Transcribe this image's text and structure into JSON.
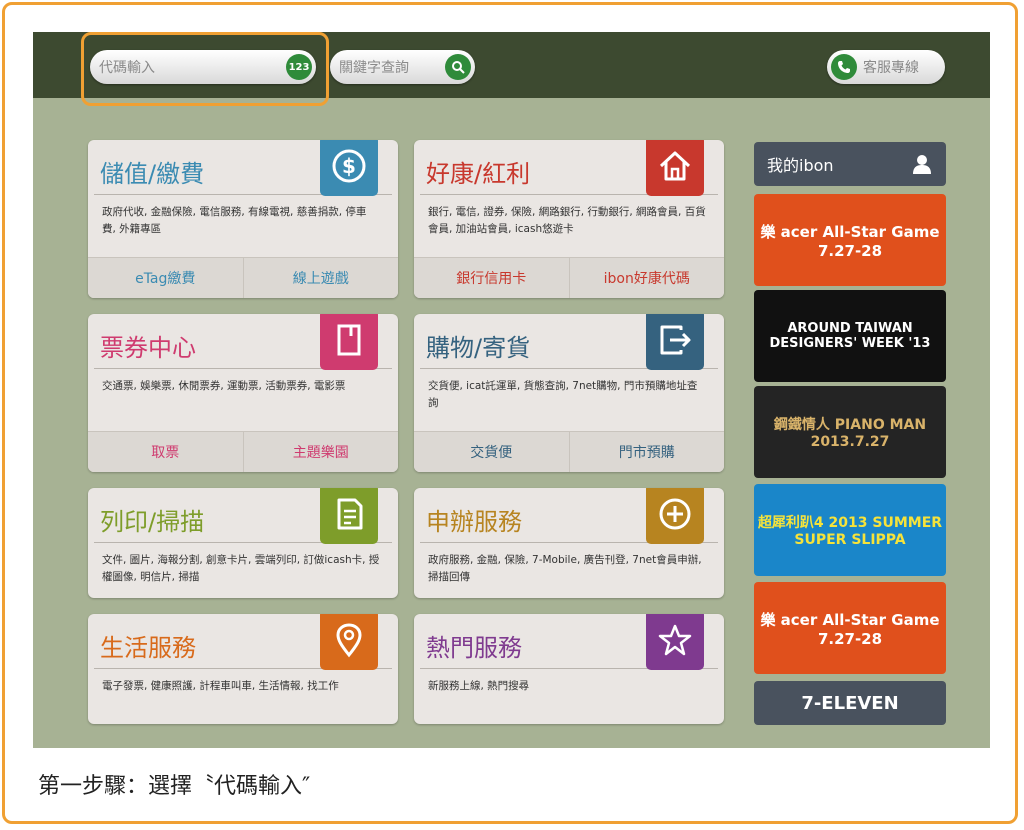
{
  "topbar": {
    "code_input_label": "代碼輸入",
    "code_badge": "123",
    "keyword_search_label": "關鍵字查詢",
    "customer_service_label": "客服專線"
  },
  "cards": [
    {
      "title": "儲值/繳費",
      "desc": "政府代收, 金融保險, 電信服務, 有線電視, 慈善捐款, 停車費, 外籍專區",
      "buttons": [
        "eTag繳費",
        "線上遊戲"
      ],
      "color": "#3b8bb2"
    },
    {
      "title": "好康/紅利",
      "desc": "銀行, 電信, 證券, 保險, 網路銀行, 行動銀行, 網路會員, 百貨會員, 加油站會員, icash悠遊卡",
      "buttons": [
        "銀行信用卡",
        "ibon好康代碼"
      ],
      "color": "#c8382d"
    },
    {
      "title": "票券中心",
      "desc": "交通票, 娛樂票, 休閒票券, 運動票, 活動票券, 電影票",
      "buttons": [
        "取票",
        "主題樂園"
      ],
      "color": "#cf3b6f"
    },
    {
      "title": "購物/寄貨",
      "desc": "交貨便, icat託運單, 貨態查詢, 7net購物, 門市預購地址查詢",
      "buttons": [
        "交貨便",
        "門市預購"
      ],
      "color": "#35627f"
    },
    {
      "title": "列印/掃描",
      "desc": "文件, 圖片, 海報分割, 創意卡片, 雲端列印, 訂做icash卡, 授權圖像, 明信片, 掃描",
      "buttons": [],
      "color": "#7e9d2a"
    },
    {
      "title": "申辦服務",
      "desc": "政府服務, 金融, 保險, 7-Mobile, 廣告刊登, 7net會員申辦, 掃描回傳",
      "buttons": [],
      "color": "#b78420"
    },
    {
      "title": "生活服務",
      "desc": "電子發票, 健康照護, 計程車叫車, 生活情報, 找工作",
      "buttons": [],
      "color": "#d86a1b"
    },
    {
      "title": "熱門服務",
      "desc": "新服務上線, 熱門搜尋",
      "buttons": [],
      "color": "#7f3a8f"
    }
  ],
  "sidebar": {
    "my_ibon_label": "我的ibon",
    "banners": [
      {
        "text": "樂 acer All-Star Game 7.27-28",
        "bg": "#e0501c"
      },
      {
        "text": "AROUND TAIWAN DESIGNERS' WEEK '13",
        "bg": "#111111"
      },
      {
        "text": "鋼鐵情人 PIANO MAN 2013.7.27",
        "bg": "#242424"
      },
      {
        "text": "超犀利趴4 2013 SUMMER SUPER SLIPPA",
        "bg": "#1a86c9"
      },
      {
        "text": "樂 acer All-Star Game 7.27-28",
        "bg": "#e0501c"
      }
    ],
    "footer_label": "7-ELEVEN"
  },
  "caption": "第一步驟：選擇〝代碼輸入″"
}
